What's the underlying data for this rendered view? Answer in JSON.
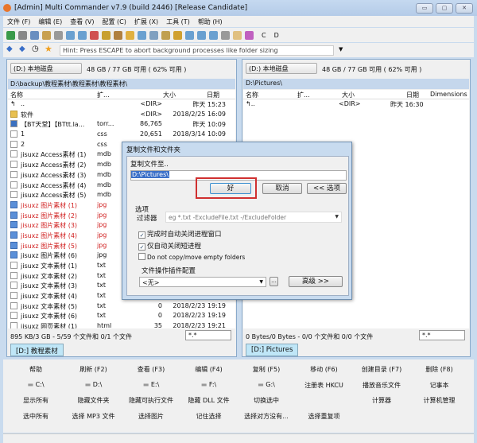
{
  "window": {
    "title": "[Admin] Multi Commander  v7.9 (build 2446) [Release Candidate]",
    "controls": [
      "▭",
      "▢",
      "✕"
    ]
  },
  "menu": [
    "文件 (F)",
    "编辑 (E)",
    "查看 (V)",
    "配置 (C)",
    "扩展 (X)",
    "工具 (T)",
    "帮助 (H)"
  ],
  "toolbar": {
    "drive_c": "C",
    "drive_d": "D"
  },
  "hint": "Hint: Press ESCAPE to abort background processes like folder sizing",
  "left": {
    "drive": "(D:) 本地磁盘",
    "free": "48 GB / 77 GB 可用 ( 62% 可用 )",
    "path": "D:\\backup\\教程素材\\教程素材\\教程素材\\",
    "columns": [
      "名称",
      "扩...",
      "大小",
      "日期"
    ],
    "rows": [
      {
        "name": "..",
        "ext": "",
        "size": "<DIR>",
        "date": "昨天 15:23",
        "icon": "up",
        "red": false
      },
      {
        "name": "软件",
        "ext": "",
        "size": "<DIR>",
        "date": "2018/2/25 16:09",
        "icon": "dir",
        "red": false
      },
      {
        "name": "【BT天堂】【BTtt.la...",
        "ext": "torr...",
        "size": "86,765",
        "date": "昨天 10:09",
        "icon": "bt",
        "red": false
      },
      {
        "name": "1",
        "ext": "css",
        "size": "20,651",
        "date": "2018/3/14 10:09",
        "icon": "file",
        "red": false
      },
      {
        "name": "2",
        "ext": "css",
        "size": "",
        "date": "",
        "icon": "file",
        "red": false
      },
      {
        "name": "jisuxz Access素材 (1)",
        "ext": "mdb",
        "size": "",
        "date": "",
        "icon": "file",
        "red": false
      },
      {
        "name": "jisuxz Access素材 (2)",
        "ext": "mdb",
        "size": "",
        "date": "",
        "icon": "file",
        "red": false
      },
      {
        "name": "jisuxz Access素材 (3)",
        "ext": "mdb",
        "size": "",
        "date": "",
        "icon": "file",
        "red": false
      },
      {
        "name": "jisuxz Access素材 (4)",
        "ext": "mdb",
        "size": "",
        "date": "",
        "icon": "file",
        "red": false
      },
      {
        "name": "jisuxz Access素材 (5)",
        "ext": "mdb",
        "size": "",
        "date": "",
        "icon": "file",
        "red": false
      },
      {
        "name": "jisuxz 图片素材 (1)",
        "ext": "jpg",
        "size": "",
        "date": "",
        "icon": "jpg",
        "red": true
      },
      {
        "name": "jisuxz 图片素材 (2)",
        "ext": "jpg",
        "size": "",
        "date": "",
        "icon": "jpg",
        "red": true
      },
      {
        "name": "jisuxz 图片素材 (3)",
        "ext": "jpg",
        "size": "",
        "date": "",
        "icon": "jpg",
        "red": true
      },
      {
        "name": "jisuxz 图片素材 (4)",
        "ext": "jpg",
        "size": "",
        "date": "",
        "icon": "jpg",
        "red": true
      },
      {
        "name": "jisuxz 图片素材 (5)",
        "ext": "jpg",
        "size": "",
        "date": "",
        "icon": "jpg",
        "red": true
      },
      {
        "name": "jisuxz 图片素材 (6)",
        "ext": "jpg",
        "size": "",
        "date": "",
        "icon": "jpg",
        "red": false
      },
      {
        "name": "jisuxz 文本素材 (1)",
        "ext": "txt",
        "size": "",
        "date": "",
        "icon": "file",
        "red": false
      },
      {
        "name": "jisuxz 文本素材 (2)",
        "ext": "txt",
        "size": "",
        "date": "",
        "icon": "file",
        "red": false
      },
      {
        "name": "jisuxz 文本素材 (3)",
        "ext": "txt",
        "size": "",
        "date": "",
        "icon": "file",
        "red": false
      },
      {
        "name": "jisuxz 文本素材 (4)",
        "ext": "txt",
        "size": "",
        "date": "",
        "icon": "file",
        "red": false
      },
      {
        "name": "jisuxz 文本素材 (5)",
        "ext": "txt",
        "size": "0",
        "date": "2018/2/23 19:19",
        "icon": "file",
        "red": false
      },
      {
        "name": "jisuxz 文本素材 (6)",
        "ext": "txt",
        "size": "0",
        "date": "2018/2/23 19:19",
        "icon": "file",
        "red": false
      },
      {
        "name": "jisuxz 网页素材 (1)",
        "ext": "html",
        "size": "35",
        "date": "2018/2/23 19:21",
        "icon": "file",
        "red": false
      }
    ],
    "status": "895 KB/3 GB - 5/59 个文件和 0/1 个文件",
    "filter": "*.*",
    "tab": "[D:] 教程素材"
  },
  "right": {
    "drive": "(D:) 本地磁盘",
    "free": "48 GB / 77 GB 可用 ( 62% 可用 )",
    "path": "D:\\Pictures\\",
    "columns": [
      "名称",
      "扩...",
      "大小",
      "日期",
      "Dimensions"
    ],
    "rows": [
      {
        "name": "..",
        "ext": "",
        "size": "<DIR>",
        "date": "昨天 16:30"
      }
    ],
    "status": "0 Bytes/0 Bytes - 0/0 个文件和 0/0 个文件",
    "filter": "*.*",
    "tab": "[D:] Pictures"
  },
  "dialog": {
    "title": "复制文件和文件夹",
    "label": "复制文件至..",
    "target": "D:\\Pictures\\",
    "ok": "好",
    "cancel": "取消",
    "options_btn": "<< 选项",
    "options_title": "选项",
    "filter_label": "过滤器",
    "filter_placeholder": "eg *.txt -ExcludeFile.txt -/ExcludeFolder",
    "checkboxes": [
      {
        "label": "完成时自动关闭进程窗口",
        "checked": true
      },
      {
        "label": "仅自动关闭短进程",
        "checked": true
      },
      {
        "label": "Do not copy/move empty folders",
        "checked": false
      }
    ],
    "plugin_label": "文件操作插件配置",
    "plugin_value": "<无>",
    "browse": "...",
    "advanced": "高级 >>"
  },
  "buttons": [
    [
      "帮助",
      "刷新 (F2)",
      "查看 (F3)",
      "编辑 (F4)",
      "复制 (F5)",
      "移动 (F6)",
      "创建目录 (F7)",
      "删除 (F8)"
    ],
    [
      "C:\\",
      "D:\\",
      "E:\\",
      "F:\\",
      "G:\\",
      "注册表 HKCU",
      "播放音乐文件",
      "记事本"
    ],
    [
      "显示所有",
      "隐藏文件夹",
      "隐藏可执行文件",
      "隐藏 DLL 文件",
      "切换选中",
      "",
      "计算器",
      "计算机管理"
    ],
    [
      "选中所有",
      "选择 MP3 文件",
      "选择图片",
      "记住选择",
      "选择对方没有...",
      "选择重复项",
      "",
      ""
    ]
  ],
  "colors": {
    "highlight_box": "#d03030",
    "selection": "#3a6fc8",
    "red_file": "#d02020"
  }
}
